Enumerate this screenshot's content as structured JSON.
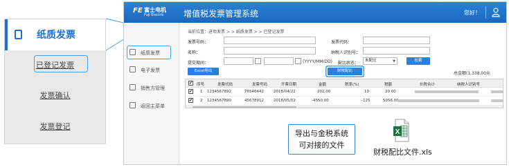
{
  "left_panel": {
    "title": "纸质发票",
    "items": [
      "已登记发票",
      "发票确认",
      "发票登记"
    ]
  },
  "header": {
    "logo_mark": "FE",
    "logo_cn": "富士电机",
    "logo_en": "Fuji Electric",
    "title": "增值税发票管理系统",
    "greeting": "您好！"
  },
  "sidebar": {
    "items": [
      "纸质发票",
      "电子发票",
      "销售方管理",
      "返回主菜单"
    ]
  },
  "breadcrumb": "当前位置：进项发票 > > 纸质发票 > > 已登记发票",
  "form": {
    "invoice_no_label": "发票号码：",
    "invoice_code_label": "发票代码：",
    "name_label": "名称：",
    "taxpayer_id_label": "纳税人识别号：",
    "submit_period_label": "提交期间：",
    "date_hint": "(YYYY/MM/DD)",
    "match_status_label": "配比状态：",
    "match_status_value": "未配比",
    "search_button": "检索",
    "excel_button": "Excel导出",
    "tax_match_button": "财税配比",
    "total": "总金额(1,338.00元"
  },
  "table": {
    "headers": [
      "序号",
      "发票代码",
      "发票号码",
      "开票日期",
      "金额",
      "税率(%)",
      "税额",
      "价税合计",
      "纳税人识别号"
    ],
    "rows": [
      {
        "no": "1",
        "code": "1234567892",
        "number": "76546442",
        "date": "2018/04/22",
        "amount": "202.00",
        "rate": "10",
        "tax": "20.00"
      },
      {
        "no": "2",
        "code": "1234567890",
        "number": "45678912",
        "date": "2018/05/02",
        "amount": "-4550.00",
        "rate": "-125",
        "tax": "5056.00"
      }
    ],
    "check_mark": "✔"
  },
  "callout": {
    "line1": "导出与金税系统",
    "line2": "可对接的文件"
  },
  "file": {
    "name": "财税配比文件.xls",
    "icon_letter": "X"
  },
  "colors": {
    "accent": "#1f6fd0",
    "header_blue": "#1b67bd",
    "highlight": "#4aa0e8",
    "excel_green": "#1e7145"
  }
}
